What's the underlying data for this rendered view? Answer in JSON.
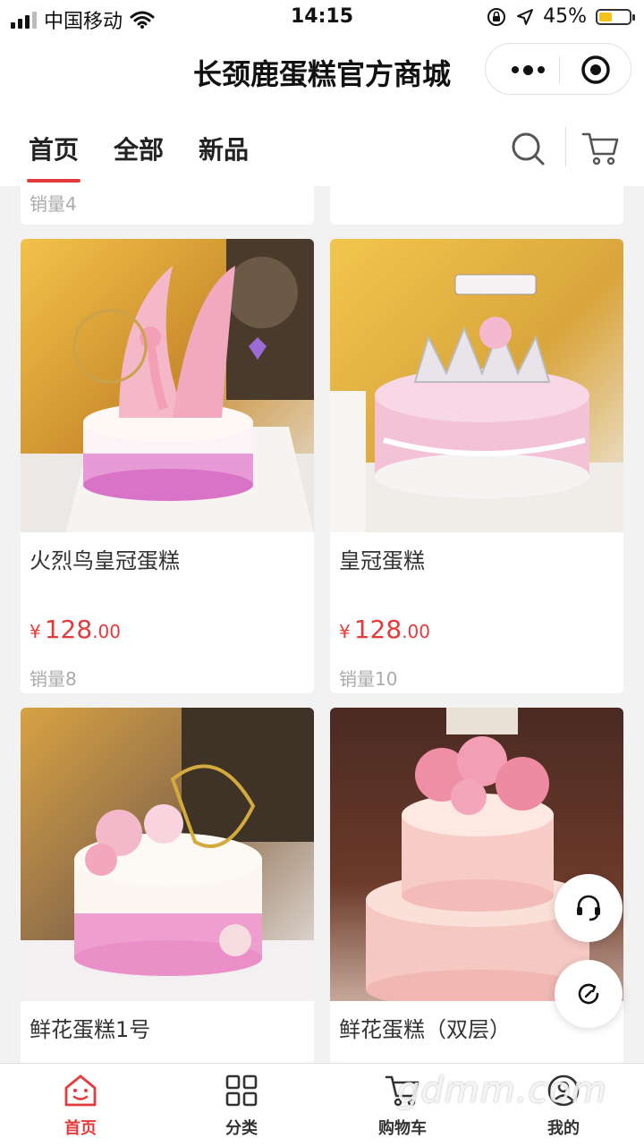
{
  "status_bar": {
    "carrier": "中国移动",
    "time": "14:15",
    "battery_percent": "45%",
    "battery_level": 0.45,
    "icons": [
      "signal-icon",
      "wifi-icon",
      "rotation-lock-icon",
      "location-icon",
      "battery-icon"
    ]
  },
  "title_bar": {
    "title": "长颈鹿蛋糕官方商城",
    "icons": [
      "more-dots-icon",
      "close-target-icon"
    ]
  },
  "nav": {
    "tabs": [
      {
        "label": "首页",
        "active": true
      },
      {
        "label": "全部",
        "active": false
      },
      {
        "label": "新品",
        "active": false
      }
    ],
    "icons": [
      "search-icon",
      "cart-icon"
    ]
  },
  "products": {
    "partial_top_sales": "销量4",
    "items": [
      {
        "name": "火烈鸟皇冠蛋糕",
        "currency": "¥",
        "price_int": "128",
        "price_dec": ".00",
        "sales": "销量8",
        "image": "flamingo-crown-cake-photo"
      },
      {
        "name": "皇冠蛋糕",
        "currency": "¥",
        "price_int": "128",
        "price_dec": ".00",
        "sales": "销量10",
        "image": "crown-cake-photo"
      },
      {
        "name": "鲜花蛋糕1号",
        "image": "flower-cake-1-photo"
      },
      {
        "name": "鲜花蛋糕（双层）",
        "image": "flower-cake-double-layer-photo"
      }
    ]
  },
  "floating": {
    "icons": [
      "customer-service-icon",
      "refresh-icon"
    ]
  },
  "tab_bar": {
    "items": [
      {
        "label": "首页",
        "icon": "home-face-icon",
        "active": true
      },
      {
        "label": "分类",
        "icon": "category-grid-icon",
        "active": false
      },
      {
        "label": "购物车",
        "icon": "cart-icon",
        "active": false
      },
      {
        "label": "我的",
        "icon": "profile-icon",
        "active": false
      }
    ]
  },
  "watermark": "gdmm.com",
  "colors": {
    "accent": "#e33b3b",
    "background": "#f2f2f2",
    "battery": "#f4c21d"
  }
}
